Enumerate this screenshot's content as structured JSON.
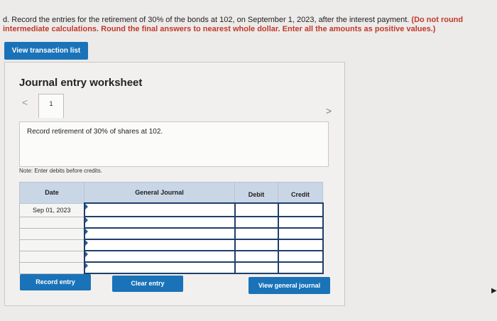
{
  "question": {
    "label": "d.",
    "text": "Record the entries for the retirement of 30% of the bonds at 102, on September 1, 2023, after the interest payment.",
    "instruction": "(Do not round intermediate calculations. Round the final answers to nearest whole dollar. Enter all the amounts as positive values.)"
  },
  "buttons": {
    "view_transactions": "View transaction list",
    "record_entry": "Record entry",
    "clear_entry": "Clear entry",
    "view_general_journal": "View general journal"
  },
  "worksheet": {
    "title": "Journal entry worksheet",
    "prev_icon": "chevron-left-icon",
    "next_icon": "chevron-right-icon",
    "prev_glyph": "<",
    "next_glyph": ">",
    "tab_number": "1",
    "description": "Record retirement of 30% of shares at 102.",
    "note": "Note: Enter debits before credits."
  },
  "table": {
    "headers": {
      "date": "Date",
      "account": "General Journal",
      "debit": "Debit",
      "credit": "Credit"
    },
    "rows": [
      {
        "date": "Sep 01, 2023",
        "account": "",
        "debit": "",
        "credit": ""
      },
      {
        "date": "",
        "account": "",
        "debit": "",
        "credit": ""
      },
      {
        "date": "",
        "account": "",
        "debit": "",
        "credit": ""
      },
      {
        "date": "",
        "account": "",
        "debit": "",
        "credit": ""
      },
      {
        "date": "",
        "account": "",
        "debit": "",
        "credit": ""
      },
      {
        "date": "",
        "account": "",
        "debit": "",
        "credit": ""
      }
    ]
  },
  "colors": {
    "primary_button": "#1a73b8",
    "header_bg": "#c9d6e6",
    "input_border": "#1f3f6a"
  },
  "page_edge_glyph": "▶"
}
